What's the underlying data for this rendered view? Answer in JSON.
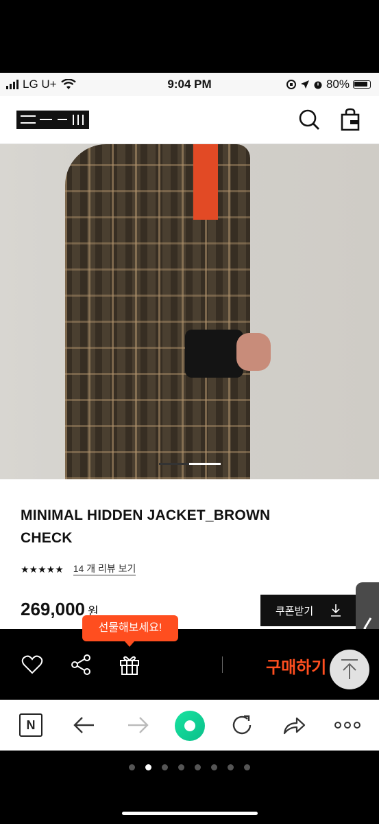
{
  "status_bar": {
    "carrier": "LG U+",
    "time": "9:04 PM",
    "battery": "80%"
  },
  "header": {
    "logo_icon": "brand-logo",
    "search_icon": "search-icon",
    "bag_icon": "shopping-bag-icon"
  },
  "hero": {
    "image_description_icon": "product-photo",
    "slide_index": 2,
    "slide_count": 2
  },
  "product": {
    "title": "MINIMAL HIDDEN JACKET_BROWN CHECK",
    "stars": "★★★★★",
    "rating_fraction": 0.9,
    "review_link": "14 개 리뷰 보기",
    "price": "269,000",
    "currency": "원",
    "coupon_label": "쿠폰받기"
  },
  "action_bar": {
    "gift_tooltip": "선물해보세요!",
    "buy_label": "구매하기"
  },
  "browser_bar": {
    "home_label": "N"
  },
  "pager": {
    "count": 8,
    "active": 1
  },
  "colors": {
    "accent": "#ff4e1f",
    "background": "#000000",
    "browser_green": "#1ee0a5"
  }
}
